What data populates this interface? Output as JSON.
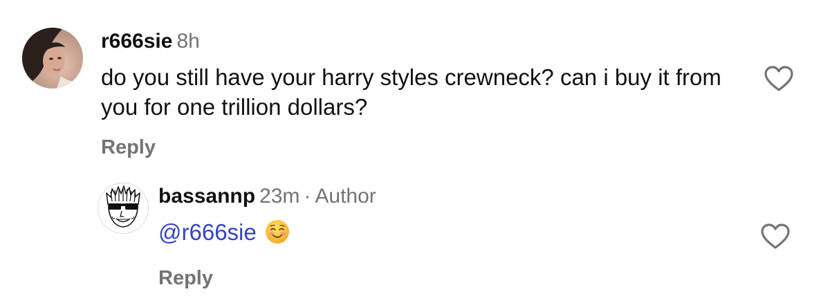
{
  "comments": [
    {
      "username": "r666sie",
      "time": "8h",
      "text": "do you still have your harry styles crewneck? can i buy it from you for one trillion dollars?",
      "reply_label": "Reply",
      "like_icon": "heart-icon"
    },
    {
      "username": "bassannp",
      "time": "23m",
      "separator": "·",
      "author_label": "Author",
      "mention": "@r666sie",
      "emoji": "☺️",
      "reply_label": "Reply",
      "like_icon": "heart-icon"
    }
  ],
  "colors": {
    "username": "#111111",
    "meta": "#737373",
    "mention": "#3542c4",
    "text": "#111111"
  }
}
